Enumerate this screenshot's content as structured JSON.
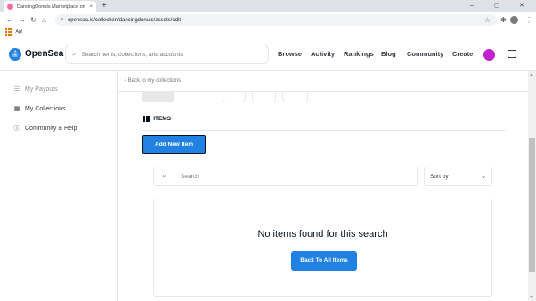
{
  "browser": {
    "tab_title": "DancingDonuts Marketplace on",
    "tab_close": "×",
    "new_tab": "+",
    "url": "opensea.io/collection/dancingdonuts/assets/edit",
    "bookmark_apps": "Apl",
    "window_controls": [
      "–",
      "▢",
      "✕"
    ]
  },
  "header": {
    "brand": "OpenSea",
    "search_placeholder": "Search items, collections, and accounts",
    "nav": [
      "Browse",
      "Activity",
      "Rankings",
      "Blog",
      "Community",
      "Create"
    ],
    "accent_color": "#2081e2",
    "avatar_color": "#c21fcf"
  },
  "sidebar": {
    "items": [
      {
        "label": "My Payouts",
        "icon": "list-icon"
      },
      {
        "label": "My Collections",
        "icon": "collections-icon"
      },
      {
        "label": "Community & Help",
        "icon": "info-icon"
      }
    ]
  },
  "main": {
    "back_link": "Back to my collections",
    "section_title": "ITEMS",
    "add_button": "Add New Item",
    "search_placeholder": "Search",
    "sort_label": "Sort by",
    "empty_message": "No items found for this search",
    "back_all_button": "Back To All Items"
  }
}
